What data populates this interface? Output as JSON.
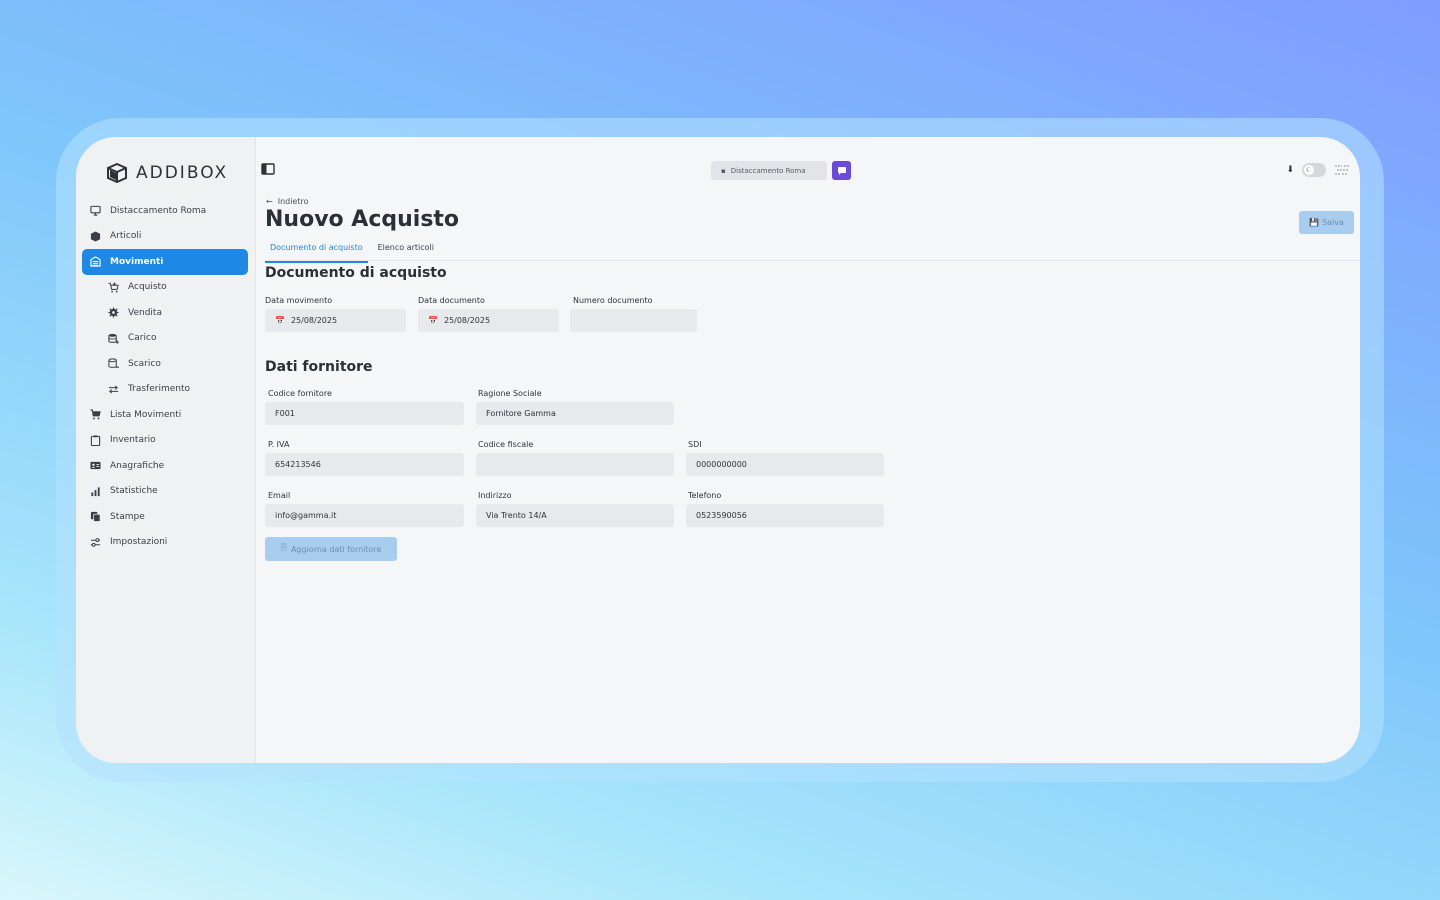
{
  "app": {
    "logo_text": "ADDIBOX"
  },
  "topbar": {
    "store_label": "Distaccamento Roma"
  },
  "sidebar": {
    "items": [
      {
        "label": "Distaccamento Roma",
        "icon": "monitor-icon"
      },
      {
        "label": "Articoli",
        "icon": "cube-icon"
      },
      {
        "label": "Movimenti",
        "icon": "warehouse-icon",
        "active": true
      },
      {
        "label": "Acquisto",
        "icon": "cart-plus-icon",
        "sub": true
      },
      {
        "label": "Vendita",
        "icon": "gear-icon",
        "sub": true
      },
      {
        "label": "Carico",
        "icon": "database-plus-icon",
        "sub": true
      },
      {
        "label": "Scarico",
        "icon": "database-minus-icon",
        "sub": true
      },
      {
        "label": "Trasferimento",
        "icon": "swap-icon",
        "sub": true
      },
      {
        "label": "Lista Movimenti",
        "icon": "cart-icon"
      },
      {
        "label": "Inventario",
        "icon": "clipboard-icon"
      },
      {
        "label": "Anagrafiche",
        "icon": "id-card-icon"
      },
      {
        "label": "Statistiche",
        "icon": "bar-chart-icon"
      },
      {
        "label": "Stampe",
        "icon": "copy-icon"
      },
      {
        "label": "Impostazioni",
        "icon": "sliders-icon"
      }
    ]
  },
  "page": {
    "back_label": "Indietro",
    "title": "Nuovo Acquisto",
    "save_label": "Salva",
    "tabs": [
      {
        "label": "Documento di acquisto",
        "active": true
      },
      {
        "label": "Elenco articoli",
        "active": false
      }
    ]
  },
  "documento": {
    "section_title": "Documento di acquisto",
    "data_movimento_label": "Data movimento",
    "data_movimento_value": "25/08/2025",
    "data_documento_label": "Data documento",
    "data_documento_value": "25/08/2025",
    "numero_documento_label": "Numero documento",
    "numero_documento_value": ""
  },
  "fornitore": {
    "section_title": "Dati fornitore",
    "codice_label": "Codice fornitore",
    "codice_value": "F001",
    "ragione_label": "Ragione Sociale",
    "ragione_value": "Fornitore Gamma",
    "piva_label": "P. IVA",
    "piva_value": "654213546",
    "cf_label": "Codice fiscale",
    "cf_value": "",
    "sdi_label": "SDI",
    "sdi_value": "0000000000",
    "email_label": "Email",
    "email_value": "info@gamma.it",
    "indirizzo_label": "Indirizzo",
    "indirizzo_value": "Via Trento 14/A",
    "telefono_label": "Telefono",
    "telefono_value": "0523590056",
    "update_label": "Aggiorna dati fornitore"
  },
  "colors": {
    "accent": "#1e88e5",
    "chat": "#6a4bd8"
  }
}
